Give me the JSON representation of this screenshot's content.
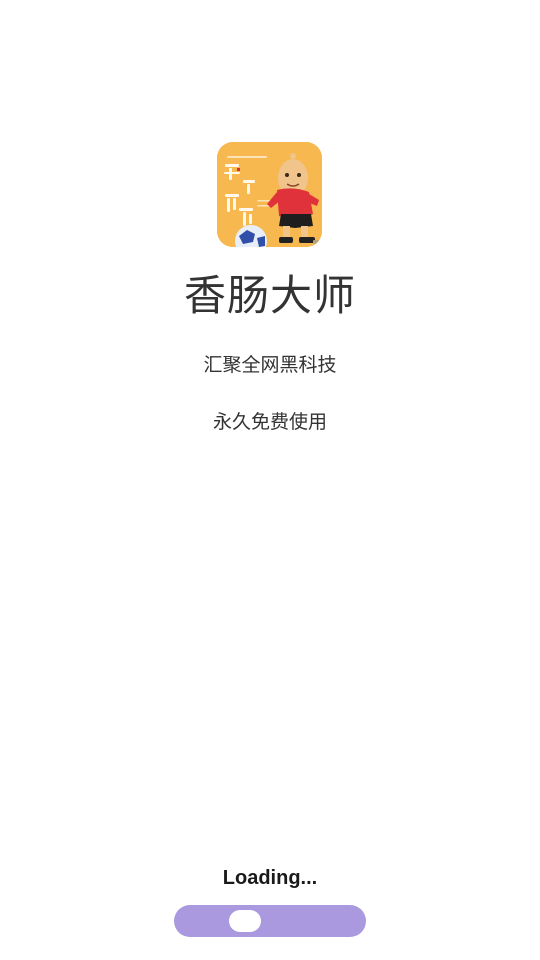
{
  "app": {
    "title": "香肠大师",
    "icon": "sausage-master-app-icon"
  },
  "taglines": {
    "line1": "汇聚全网黑科技",
    "line2": "永久免费使用"
  },
  "loading": {
    "label": "Loading...",
    "progress": 0.33,
    "track_color": "#ab99df",
    "knob_color": "#ffffff"
  },
  "colors": {
    "background": "#ffffff",
    "text": "#333333",
    "icon_background": "#f6b84f",
    "character_shirt": "#e0323a"
  }
}
